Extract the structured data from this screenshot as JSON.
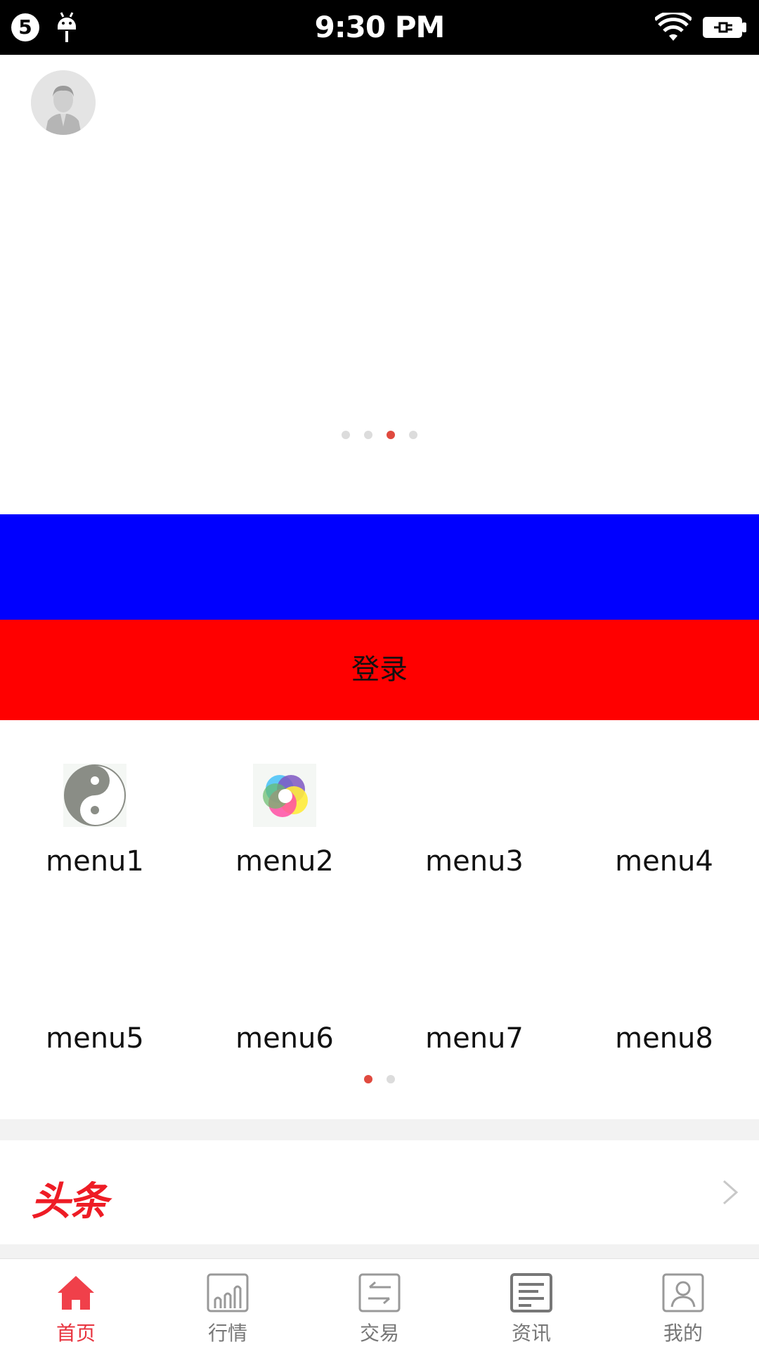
{
  "status_bar": {
    "notification_count": "5",
    "time": "9:30 PM"
  },
  "banner": {
    "avatar_icon": "user-avatar-icon",
    "page_count": 4,
    "active_page": 3
  },
  "login": {
    "label": "登录"
  },
  "menu": {
    "items": [
      {
        "label": "menu1",
        "icon": "yin-yang-icon"
      },
      {
        "label": "menu2",
        "icon": "color-swirl-icon"
      },
      {
        "label": "menu3",
        "icon": ""
      },
      {
        "label": "menu4",
        "icon": ""
      },
      {
        "label": "menu5",
        "icon": ""
      },
      {
        "label": "menu6",
        "icon": ""
      },
      {
        "label": "menu7",
        "icon": ""
      },
      {
        "label": "menu8",
        "icon": ""
      }
    ],
    "page_count": 2,
    "active_page": 1
  },
  "headline": {
    "logo_text": "头条",
    "logo_color": "#ee1c25"
  },
  "tabbar": {
    "tabs": [
      {
        "label": "首页",
        "icon": "home-icon",
        "active": true
      },
      {
        "label": "行情",
        "icon": "chart-icon",
        "active": false
      },
      {
        "label": "交易",
        "icon": "exchange-icon",
        "active": false
      },
      {
        "label": "资讯",
        "icon": "news-icon",
        "active": false
      },
      {
        "label": "我的",
        "icon": "profile-icon",
        "active": false
      }
    ]
  },
  "colors": {
    "accent_red": "#e8343f",
    "blue_band": "#0000ff",
    "login_band": "#ff0000"
  }
}
